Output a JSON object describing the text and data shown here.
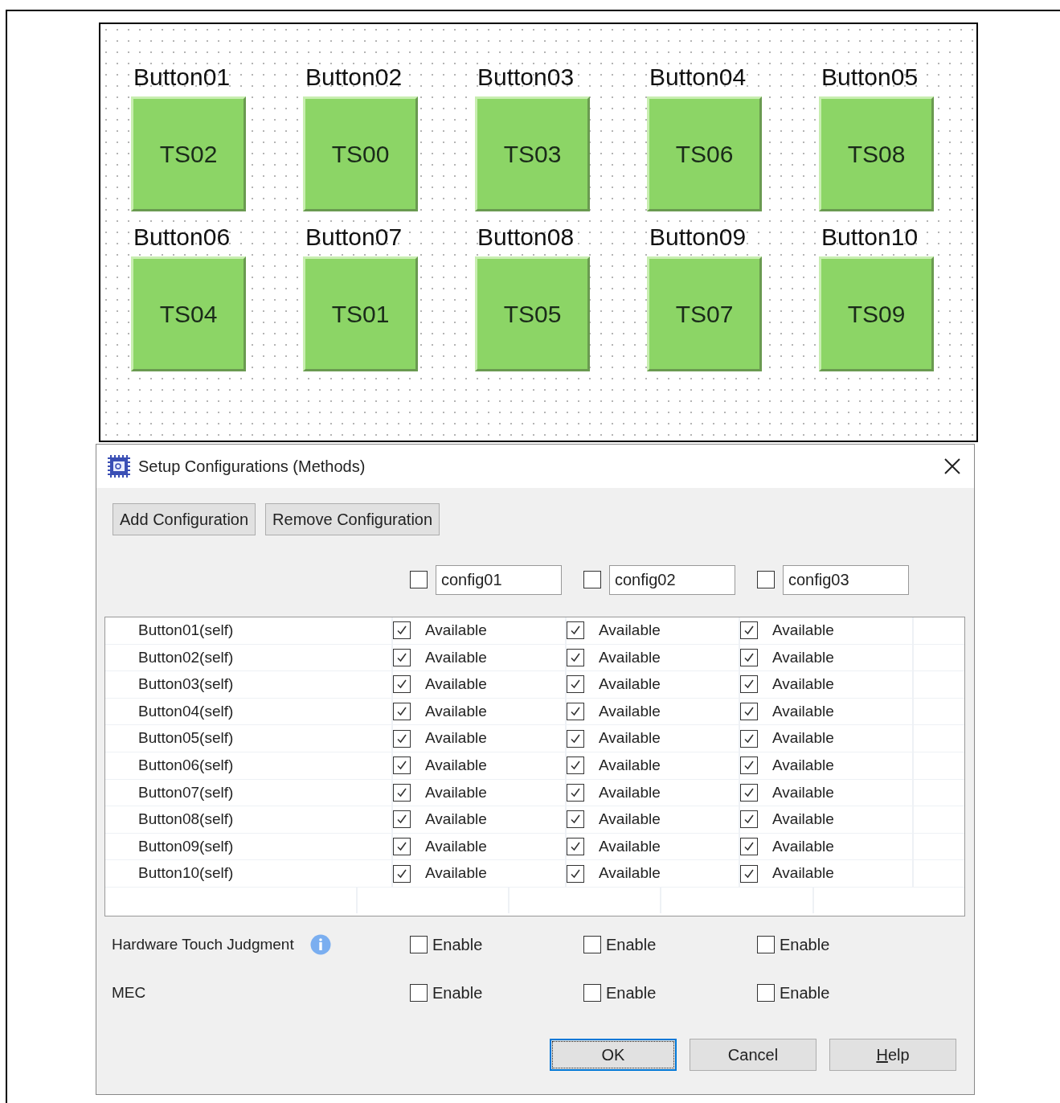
{
  "canvas": {
    "buttons": [
      {
        "label": "Button01",
        "tile": "TS02"
      },
      {
        "label": "Button02",
        "tile": "TS00"
      },
      {
        "label": "Button03",
        "tile": "TS03"
      },
      {
        "label": "Button04",
        "tile": "TS06"
      },
      {
        "label": "Button05",
        "tile": "TS08"
      },
      {
        "label": "Button06",
        "tile": "TS04"
      },
      {
        "label": "Button07",
        "tile": "TS01"
      },
      {
        "label": "Button08",
        "tile": "TS05"
      },
      {
        "label": "Button09",
        "tile": "TS07"
      },
      {
        "label": "Button10",
        "tile": "TS09"
      }
    ]
  },
  "dialog": {
    "title": "Setup Configurations (Methods)",
    "toolbar": [
      "Add Configuration",
      "Remove Configuration"
    ],
    "configs": [
      {
        "name": "config01",
        "checked": false
      },
      {
        "name": "config02",
        "checked": false
      },
      {
        "name": "config03",
        "checked": false
      }
    ],
    "rows": [
      {
        "name": "Button01(self)",
        "cells": [
          {
            "checked": true,
            "text": "Available"
          },
          {
            "checked": true,
            "text": "Available"
          },
          {
            "checked": true,
            "text": "Available"
          }
        ]
      },
      {
        "name": "Button02(self)",
        "cells": [
          {
            "checked": true,
            "text": "Available"
          },
          {
            "checked": true,
            "text": "Available"
          },
          {
            "checked": true,
            "text": "Available"
          }
        ]
      },
      {
        "name": "Button03(self)",
        "cells": [
          {
            "checked": true,
            "text": "Available"
          },
          {
            "checked": true,
            "text": "Available"
          },
          {
            "checked": true,
            "text": "Available"
          }
        ]
      },
      {
        "name": "Button04(self)",
        "cells": [
          {
            "checked": true,
            "text": "Available"
          },
          {
            "checked": true,
            "text": "Available"
          },
          {
            "checked": true,
            "text": "Available"
          }
        ]
      },
      {
        "name": "Button05(self)",
        "cells": [
          {
            "checked": true,
            "text": "Available"
          },
          {
            "checked": true,
            "text": "Available"
          },
          {
            "checked": true,
            "text": "Available"
          }
        ]
      },
      {
        "name": "Button06(self)",
        "cells": [
          {
            "checked": true,
            "text": "Available"
          },
          {
            "checked": true,
            "text": "Available"
          },
          {
            "checked": true,
            "text": "Available"
          }
        ]
      },
      {
        "name": "Button07(self)",
        "cells": [
          {
            "checked": true,
            "text": "Available"
          },
          {
            "checked": true,
            "text": "Available"
          },
          {
            "checked": true,
            "text": "Available"
          }
        ]
      },
      {
        "name": "Button08(self)",
        "cells": [
          {
            "checked": true,
            "text": "Available"
          },
          {
            "checked": true,
            "text": "Available"
          },
          {
            "checked": true,
            "text": "Available"
          }
        ]
      },
      {
        "name": "Button09(self)",
        "cells": [
          {
            "checked": true,
            "text": "Available"
          },
          {
            "checked": true,
            "text": "Available"
          },
          {
            "checked": true,
            "text": "Available"
          }
        ]
      },
      {
        "name": "Button10(self)",
        "cells": [
          {
            "checked": true,
            "text": "Available"
          },
          {
            "checked": true,
            "text": "Available"
          },
          {
            "checked": true,
            "text": "Available"
          }
        ]
      }
    ],
    "options": [
      {
        "label": "Hardware Touch Judgment",
        "info": true,
        "cells": [
          {
            "checked": false,
            "text": "Enable"
          },
          {
            "checked": false,
            "text": "Enable"
          },
          {
            "checked": false,
            "text": "Enable"
          }
        ]
      },
      {
        "label": "MEC",
        "info": false,
        "cells": [
          {
            "checked": false,
            "text": "Enable"
          },
          {
            "checked": false,
            "text": "Enable"
          },
          {
            "checked": false,
            "text": "Enable"
          }
        ]
      }
    ],
    "footer": [
      {
        "label": "OK",
        "default": true,
        "mnemonic": false
      },
      {
        "label": "Cancel",
        "default": false,
        "mnemonic": false
      },
      {
        "label": "Help",
        "default": false,
        "mnemonic": true
      }
    ]
  }
}
